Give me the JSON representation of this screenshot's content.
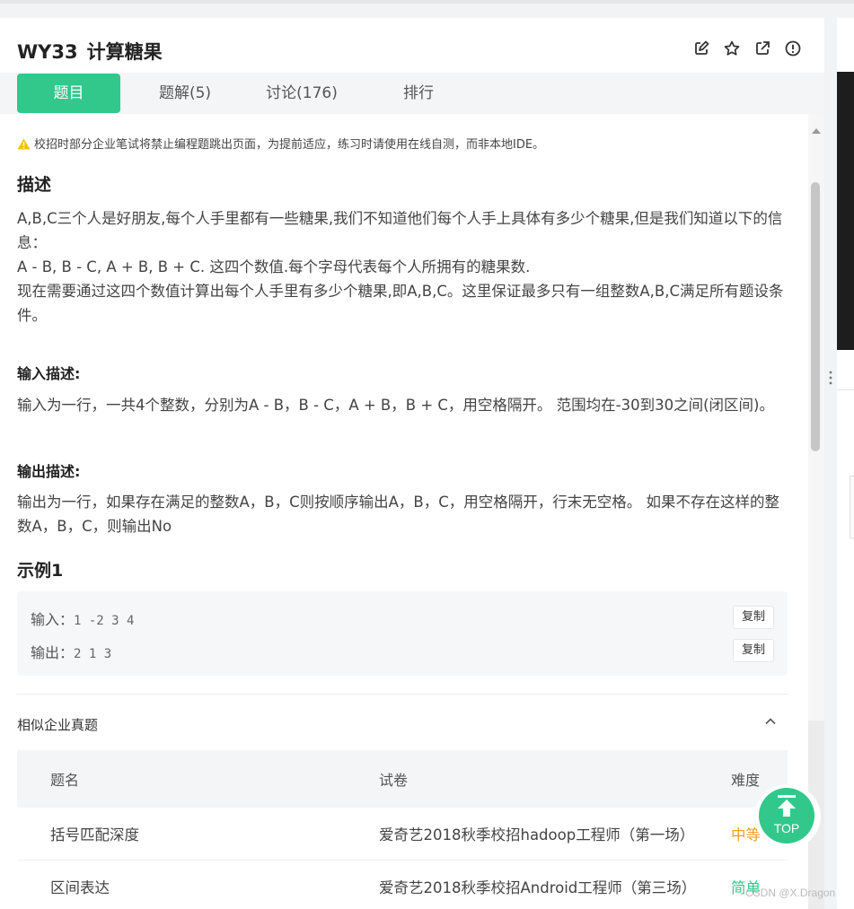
{
  "header": {
    "problem_id": "WY33",
    "problem_name": "计算糖果",
    "icons": [
      "edit-icon",
      "star-icon",
      "external-link-icon",
      "info-icon"
    ]
  },
  "tabs": [
    {
      "label": "题目",
      "active": true
    },
    {
      "label": "题解(5)",
      "active": false
    },
    {
      "label": "讨论(176)",
      "active": false
    },
    {
      "label": "排行",
      "active": false
    }
  ],
  "warning": "校招时部分企业笔试将禁止编程题跳出页面，为提前适应，练习时请使用在线自测，而非本地IDE。",
  "description": {
    "heading": "描述",
    "lines": [
      "A,B,C三个人是好朋友,每个人手里都有一些糖果,我们不知道他们每个人手上具体有多少个糖果,但是我们知道以下的信息：",
      "A - B, B - C, A + B, B + C. 这四个数值.每个字母代表每个人所拥有的糖果数.",
      "现在需要通过这四个数值计算出每个人手里有多少个糖果,即A,B,C。这里保证最多只有一组整数A,B,C满足所有题设条件。"
    ]
  },
  "input_desc": {
    "heading": "输入描述:",
    "text": "输入为一行，一共4个整数，分别为A - B，B - C，A + B，B + C，用空格隔开。 范围均在-30到30之间(闭区间)。"
  },
  "output_desc": {
    "heading": "输出描述:",
    "text": "输出为一行，如果存在满足的整数A，B，C则按顺序输出A，B，C，用空格隔开，行末无空格。 如果不存在这样的整数A，B，C，则输出No"
  },
  "example": {
    "heading": "示例1",
    "input_label": "输入：",
    "input_value": "1 -2 3 4",
    "output_label": "输出：",
    "output_value": "2 1 3",
    "copy_label": "复制"
  },
  "similar": {
    "title": "相似企业真题",
    "columns": [
      "题名",
      "试卷",
      "难度"
    ],
    "rows": [
      {
        "name": "括号匹配深度",
        "paper": "爱奇艺2018秋季校招hadoop工程师（第一场）",
        "difficulty": "中等"
      },
      {
        "name": "区间表达",
        "paper": "爱奇艺2018秋季校招Android工程师（第三场）",
        "difficulty": "简单"
      }
    ]
  },
  "top_button": "TOP",
  "watermark": "CSDN @X.Dragon",
  "colors": {
    "accent": "#32c88c",
    "medium": "#f0a020",
    "warning": "#f2c200"
  }
}
